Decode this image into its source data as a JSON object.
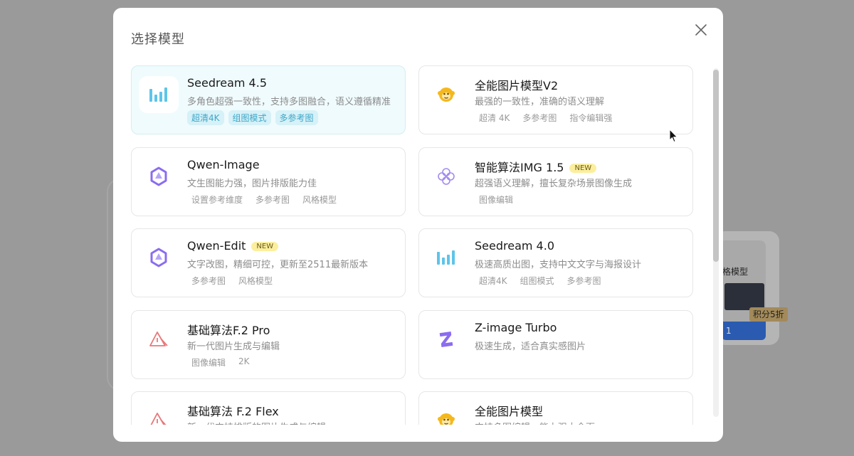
{
  "modal": {
    "title": "选择模型"
  },
  "models": [
    {
      "name": "Seedream 4.5",
      "badge": "",
      "desc": "多角色超强一致性，支持多图融合，语义遵循精准",
      "tags": [
        "超清4K",
        "组图模式",
        "多参考图"
      ],
      "icon": "bar-chart-icon",
      "selected": true
    },
    {
      "name": "全能图片模型V2",
      "badge": "",
      "desc": "最强的一致性，准确的语义理解",
      "tags": [
        "超清 4K",
        "多参考图",
        "指令编辑强"
      ],
      "icon": "monkey-icon",
      "selected": false
    },
    {
      "name": "Qwen-Image",
      "badge": "",
      "desc": "文生图能力强，图片排版能力佳",
      "tags": [
        "设置参考维度",
        "多参考图",
        "风格模型"
      ],
      "icon": "qwen-icon",
      "selected": false
    },
    {
      "name": "智能算法IMG 1.5",
      "badge": "NEW",
      "desc": "超强语义理解，擅长复杂场景图像生成",
      "tags": [
        "图像编辑"
      ],
      "icon": "knot-icon",
      "selected": false
    },
    {
      "name": "Qwen-Edit",
      "badge": "NEW",
      "desc": "文字改图，精细可控，更新至2511最新版本",
      "tags": [
        "多参考图",
        "风格模型"
      ],
      "icon": "qwen-icon",
      "selected": false
    },
    {
      "name": "Seedream 4.0",
      "badge": "",
      "desc": "极速高质出图，支持中文文字与海报设计",
      "tags": [
        "超清4K",
        "组图模式",
        "多参考图"
      ],
      "icon": "bar-chart-icon",
      "selected": false
    },
    {
      "name": "基础算法F.2 Pro",
      "badge": "",
      "desc": "新一代图片生成与编辑",
      "tags": [
        "图像编辑",
        "2K"
      ],
      "icon": "triangle-icon",
      "selected": false
    },
    {
      "name": "Z-image Turbo",
      "badge": "",
      "desc": "极速生成，适合真实感图片",
      "tags": [],
      "icon": "z-icon",
      "selected": false
    },
    {
      "name": "基础算法 F.2 Flex",
      "badge": "",
      "desc": "新一代支持排版的图片生成与编辑",
      "tags": [],
      "icon": "triangle-icon",
      "selected": false
    },
    {
      "name": "全能图片模型",
      "badge": "",
      "desc": "支持多图编辑，能力强大全面",
      "tags": [],
      "icon": "monkey-icon",
      "selected": false
    }
  ],
  "background": {
    "card_label": "格模型",
    "badge": "积分5折",
    "button": "1"
  },
  "colors": {
    "accent": "#3ea7c8",
    "selected_bg": "#f0fbfd",
    "new_badge_bg": "#fbef9e",
    "qwen": "#8b6cf0",
    "triangle": "#e8787a",
    "monkey": "#f5b81c"
  }
}
